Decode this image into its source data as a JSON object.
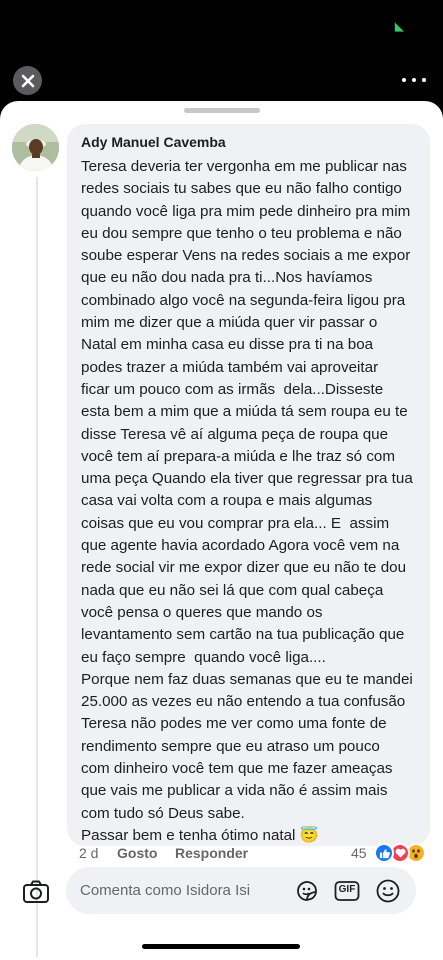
{
  "comment": {
    "author": "Ady Manuel Cavemba",
    "lines": [
      "Teresa deveria ter vergonha em me publicar nas",
      "redes sociais tu sabes que eu não falho contigo",
      "quando você liga pra mim pede dinheiro pra mim",
      "eu dou sempre que tenho o teu problema e não",
      "soube esperar Vens na redes sociais a me expor",
      "que eu não dou nada pra ti...Nos havíamos",
      "combinado algo você na segunda-feira ligou pra",
      "mim me dizer que a miúda quer vir passar o",
      "Natal em minha casa eu disse pra ti na boa",
      "podes trazer a miúda também vai aproveitar",
      "ficar um pouco com as irmãs  dela...Dissestе",
      "esta bem a mim que a miúda tá sem roupa eu te",
      "disse Teresa vê aí alguma peça de roupa que",
      "você tem aí prepara-a miúda e lhe traz só com",
      "uma peça Quando ela tiver que regressar pra tua",
      "casa vai volta com a roupa e mais algumas",
      "coisas que eu vou comprar pra ela... E  assim",
      "que agente havia acordado Agora você vem na",
      "rede social vir me expor dizer que eu não te dou",
      "nada que eu não sei lá que com qual cabeça",
      "você pensa o queres que mando os",
      "levantamento sem cartão na tua publicação que",
      "eu faço sempre  quando você liga....",
      "Porque nem faz duas semanas que eu te mandei",
      "25.000 as vezes eu não entendo a tua confusão",
      "Teresa não podes me ver como uma fonte de",
      "rendimento sempre que eu atraso um pouco",
      "com dinheiro você tem que me fazer ameaças",
      "que vais me publicar a vida não é assim mais",
      "com tudo só Deus sabe.",
      "Passar bem e tenha ótimo natal 😇"
    ],
    "time": "2 d",
    "like_label": "Gosto",
    "reply_label": "Responder",
    "reaction_count": "45"
  },
  "composer": {
    "placeholder": "Comenta como Isidora Isi",
    "gif_label": "GIF"
  },
  "icons": {
    "close": "close-icon",
    "more": "more-horizontal-icon",
    "camera": "camera-icon",
    "sticker": "sticker-icon",
    "gif": "gif-icon",
    "emoji": "emoji-icon",
    "like_reaction": "like-reaction-icon",
    "love_reaction": "love-reaction-icon",
    "wow_reaction": "wow-reaction-icon"
  },
  "colors": {
    "like_blue": "#1877f2",
    "love_red": "#f33e58",
    "wow_yellow": "#f7b125",
    "bubble_bg": "#eff1f4",
    "meta_gray": "#65676b"
  }
}
